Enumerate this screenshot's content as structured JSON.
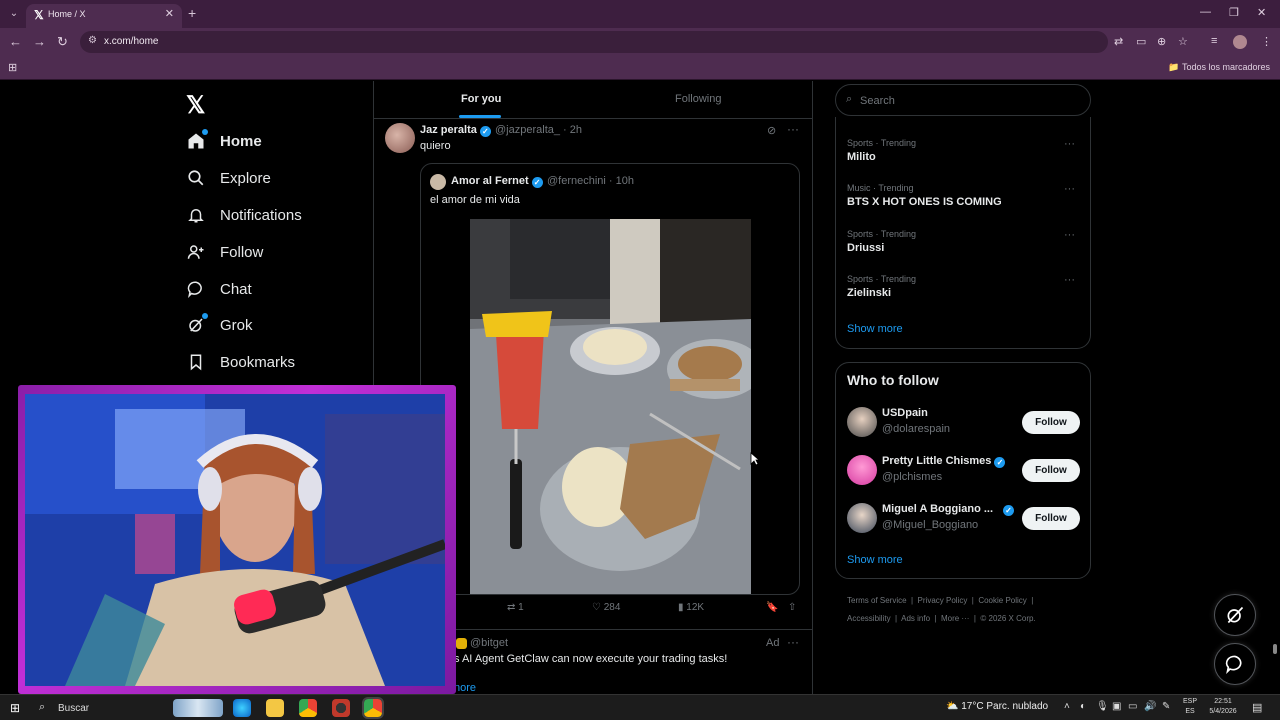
{
  "browser": {
    "tab_title": "Home / X",
    "url": "x.com/home",
    "all_bookmarks": "Todos los marcadores"
  },
  "sidebar": {
    "items": [
      {
        "label": "Home",
        "icon": "home-icon"
      },
      {
        "label": "Explore",
        "icon": "search-icon"
      },
      {
        "label": "Notifications",
        "icon": "bell-icon"
      },
      {
        "label": "Follow",
        "icon": "person-plus-icon"
      },
      {
        "label": "Chat",
        "icon": "chat-icon"
      },
      {
        "label": "Grok",
        "icon": "grok-icon"
      },
      {
        "label": "Bookmarks",
        "icon": "bookmark-icon"
      }
    ]
  },
  "feed": {
    "tabs": [
      "For you",
      "Following"
    ],
    "tweet": {
      "name": "Jaz peralta",
      "handle": "@jazperalta_ · 2h",
      "text": "quiero",
      "quote": {
        "name": "Amor al Fernet",
        "handle": "@fernechini · 10h",
        "text": "el amor de mi vida"
      },
      "replies": "",
      "reposts": "1",
      "likes": "284",
      "views": "12K"
    },
    "ad": {
      "handle": "@bitget",
      "text": "s AI Agent GetClaw can now execute your trading tasks!",
      "label": "Ad",
      "show_more": "nore"
    }
  },
  "right": {
    "search_placeholder": "Search",
    "trends": [
      {
        "category": "Sports · Trending",
        "name": "Milito"
      },
      {
        "category": "Music · Trending",
        "name": "BTS X HOT ONES IS COMING"
      },
      {
        "category": "Sports · Trending",
        "name": "Driussi"
      },
      {
        "category": "Sports · Trending",
        "name": "Zielinski"
      }
    ],
    "show_more": "Show more",
    "who_to_follow": {
      "title": "Who to follow",
      "users": [
        {
          "name": "USDpain",
          "handle": "@dolarespain",
          "verified": false
        },
        {
          "name": "Pretty Little Chismes",
          "handle": "@plchismes",
          "verified": true
        },
        {
          "name": "Miguel A Boggiano ...",
          "handle": "@Miguel_Boggiano",
          "verified": true
        }
      ],
      "follow_label": "Follow",
      "show_more": "Show more"
    },
    "footer": {
      "line1": [
        "Terms of Service",
        "Privacy Policy",
        "Cookie Policy"
      ],
      "line2": [
        "Accessibility",
        "Ads info",
        "More ···",
        "© 2026 X Corp."
      ]
    }
  },
  "taskbar": {
    "search": "Buscar",
    "weather": "17°C  Parc. nublado",
    "lang_top": "ESP",
    "lang_bottom": "ES",
    "time": "22:51",
    "date": "5/4/2026"
  },
  "colors": {
    "accent": "#1d9bf0",
    "browser_frame": "#4e2c50",
    "cam_border": "#c02fd6"
  }
}
